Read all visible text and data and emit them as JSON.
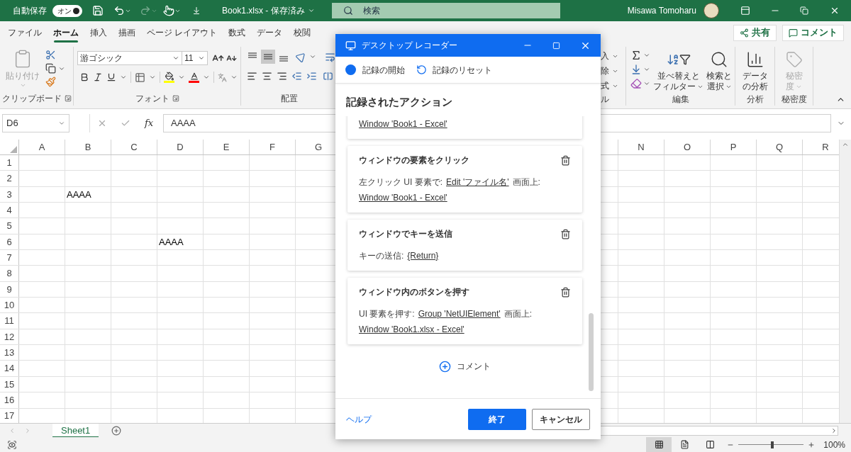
{
  "title_bar": {
    "autosave_label": "自動保存",
    "autosave": {
      "on": true,
      "label": "オン"
    },
    "redo_disabled": true,
    "file_title": "Book1.xlsx - 保存済み",
    "search_placeholder": "検索",
    "user_name": "Misawa Tomoharu"
  },
  "ribbon_tabs": [
    {
      "label": "ファイル",
      "selected": false
    },
    {
      "label": "ホーム",
      "selected": true
    },
    {
      "label": "挿入",
      "selected": false
    },
    {
      "label": "描画",
      "selected": false
    },
    {
      "label": "ページ レイアウト",
      "selected": false
    },
    {
      "label": "数式",
      "selected": false
    },
    {
      "label": "データ",
      "selected": false
    },
    {
      "label": "校閲",
      "selected": false
    }
  ],
  "share_button": "共有",
  "comment_button": "コメント",
  "clipboard_group": {
    "label": "クリップボード",
    "paste_label": "貼り付け",
    "paste_disabled": true
  },
  "font_group": {
    "label": "フォント",
    "font_name": "游ゴシック",
    "font_size": "11"
  },
  "alignment_group": {
    "label": "配置",
    "middle_align_selected": true
  },
  "cells_group": {
    "items": [
      "入",
      "除",
      "式"
    ],
    "label_fragment": "ル"
  },
  "editing_group": {
    "label": "編集",
    "sort_filter_lines": [
      "並べ替えと",
      "フィルター"
    ],
    "find_lines": [
      "検索と",
      "選択"
    ]
  },
  "analysis_group": {
    "label": "分析",
    "button_lines": [
      "データ",
      "の分析"
    ]
  },
  "sensitivity_group": {
    "label": "秘密度",
    "button_lines": [
      "秘密",
      "度"
    ],
    "disabled": true
  },
  "formula_bar": {
    "name_box": "D6",
    "function_label": "fx",
    "value": "AAAA"
  },
  "sheet": {
    "columns_left": [
      "A",
      "B",
      "C",
      "D",
      "E",
      "F",
      "G"
    ],
    "columns_right": [
      "N",
      "O",
      "P",
      "Q",
      "R"
    ],
    "rows": [
      {
        "label": "1"
      },
      {
        "label": "2"
      },
      {
        "label": "3",
        "cells": [
          {
            "kind": "empty"
          },
          {
            "kind": "text",
            "value": "AAAA"
          }
        ]
      },
      {
        "label": "4"
      },
      {
        "label": "5"
      },
      {
        "label": "6",
        "cells": [
          {
            "kind": "empty"
          },
          {
            "kind": "empty"
          },
          {
            "kind": "empty"
          },
          {
            "kind": "text",
            "value": "AAAA"
          }
        ]
      },
      {
        "label": "7"
      },
      {
        "label": "8"
      },
      {
        "label": "9"
      },
      {
        "label": "10"
      },
      {
        "label": "11"
      },
      {
        "label": "12"
      },
      {
        "label": "13"
      },
      {
        "label": "14"
      },
      {
        "label": "15"
      },
      {
        "label": "16"
      },
      {
        "label": "17"
      }
    ]
  },
  "sheet_tabs": [
    {
      "label": "Sheet1",
      "selected": true
    }
  ],
  "status_bar": {
    "views": [
      {
        "kind": "normal",
        "selected": true
      },
      {
        "kind": "page_layout",
        "selected": false
      },
      {
        "kind": "page_break",
        "selected": false
      }
    ],
    "zoom": {
      "level": 0.52,
      "label": "100%"
    }
  },
  "dialog": {
    "title": "デスクトップ レコーダー",
    "start_label": "記録の開始",
    "reset_label": "記録のリセット",
    "heading": "記録されたアクション",
    "actions": [
      {
        "kind": "partial",
        "lines": [
          [
            {
              "text": "Window 'Book1 - Excel'",
              "link": true
            }
          ]
        ]
      },
      {
        "kind": "full",
        "title": "ウィンドウの要素をクリック",
        "lines": [
          [
            {
              "text": "左クリック UI 要素で:",
              "link": false
            },
            {
              "text": "Edit 'ファイル名'",
              "link": true
            },
            {
              "text": "画面上:",
              "link": false
            }
          ],
          [
            {
              "text": "Window 'Book1 - Excel'",
              "link": true
            }
          ]
        ]
      },
      {
        "kind": "full",
        "title": "ウィンドウでキーを送信",
        "lines": [
          [
            {
              "text": "キーの送信:",
              "link": false
            },
            {
              "text": "{Return}",
              "link": true
            }
          ]
        ]
      },
      {
        "kind": "full",
        "title": "ウィンドウ内のボタンを押す",
        "lines": [
          [
            {
              "text": "UI 要素を押す:",
              "link": false
            },
            {
              "text": "Group 'NetUIElement'",
              "link": true
            },
            {
              "text": "画面上:",
              "link": false
            }
          ],
          [
            {
              "text": "Window 'Book1.xlsx - Excel'",
              "link": true
            }
          ]
        ]
      }
    ],
    "comment_label": "コメント",
    "help_link": "ヘルプ",
    "finish_button": "終了",
    "cancel_button": "キャンセル"
  }
}
